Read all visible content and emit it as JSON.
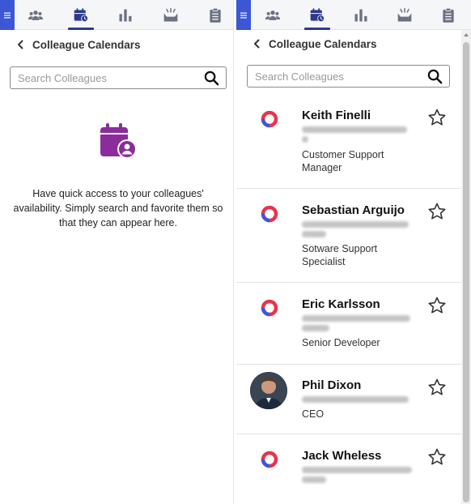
{
  "nav": {
    "menu_icon": "hamburger-menu-icon",
    "tabs": [
      {
        "icon": "people-icon",
        "active": false
      },
      {
        "icon": "calendar-clock-icon",
        "active": true
      },
      {
        "icon": "bar-chart-icon",
        "active": false
      },
      {
        "icon": "inbox-tray-icon",
        "active": false
      },
      {
        "icon": "clipboard-icon",
        "active": false
      }
    ]
  },
  "left_panel": {
    "title": "Colleague Calendars",
    "search": {
      "placeholder": "Search Colleagues",
      "value": ""
    },
    "empty_state": {
      "icon": "calendar-person-icon",
      "text": "Have quick access to your colleagues' availability. Simply search and favorite them so that they can appear here."
    }
  },
  "right_panel": {
    "title": "Colleague Calendars",
    "search": {
      "placeholder": "Search Colleagues",
      "value": ""
    },
    "colleagues": [
      {
        "name": "Keith Finelli",
        "email": "",
        "title_lines": [
          "Customer Support",
          "Manager"
        ],
        "avatar": "brand-logo-icon",
        "favorited": false
      },
      {
        "name": "Sebastian Arguijo",
        "email": "",
        "title_lines": [
          "Sotware Support",
          "Specialist"
        ],
        "avatar": "brand-logo-icon",
        "favorited": false
      },
      {
        "name": "Eric Karlsson",
        "email": "",
        "title_lines": [
          "Senior Developer"
        ],
        "avatar": "brand-logo-icon",
        "favorited": false
      },
      {
        "name": "Phil Dixon",
        "email": "",
        "title_lines": [
          "CEO"
        ],
        "avatar": "profile-photo",
        "favorited": false
      },
      {
        "name": "Jack Wheless",
        "email": "",
        "title_lines": [],
        "avatar": "brand-logo-icon",
        "favorited": false
      }
    ]
  },
  "colors": {
    "accent_blue": "#3b57d6",
    "nav_active": "#2d3a8c",
    "nav_icon": "#6b7180",
    "empty_icon_purple": "#8a2c9a",
    "logo_red": "#e8344a",
    "logo_blue": "#3f55e0"
  }
}
